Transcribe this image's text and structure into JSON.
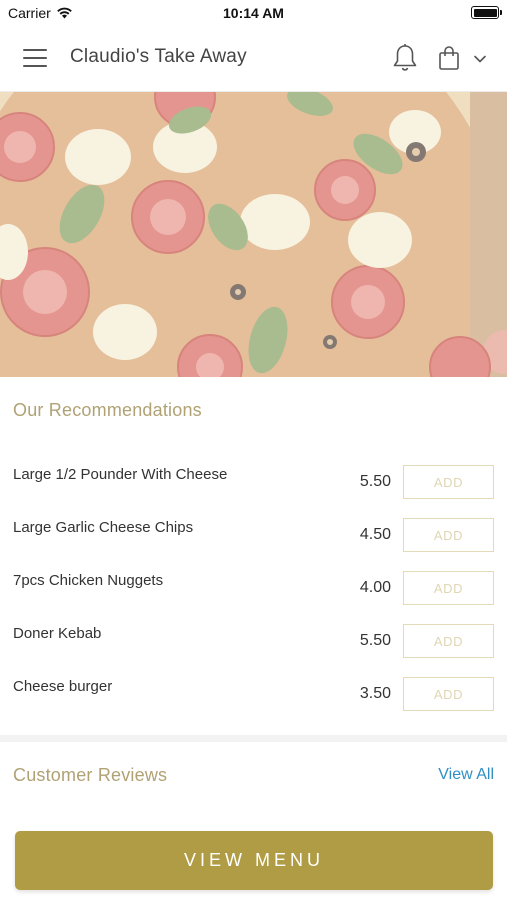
{
  "status_bar": {
    "carrier": "Carrier",
    "time": "10:14 AM"
  },
  "header": {
    "title": "Claudio's Take Away",
    "icons": [
      "menu-icon",
      "bell-icon",
      "shopping-bag-icon",
      "chevron-down-icon"
    ]
  },
  "hero": {
    "image": "pizza-photo"
  },
  "recommendations": {
    "heading": "Our Recommendations",
    "add_label": "ADD",
    "items": [
      {
        "name": "Large 1/2  Pounder With Cheese",
        "price": "5.50"
      },
      {
        "name": "Large Garlic Cheese Chips",
        "price": "4.50"
      },
      {
        "name": "7pcs Chicken Nuggets",
        "price": "4.00"
      },
      {
        "name": "Doner Kebab",
        "price": "5.50"
      },
      {
        "name": "Cheese burger",
        "price": "3.50"
      }
    ]
  },
  "reviews": {
    "heading": "Customer Reviews",
    "view_all": "View All"
  },
  "footer": {
    "view_menu": "VIEW MENU"
  },
  "colors": {
    "accent_gold": "#b19c46",
    "heading_gold": "#b0a274",
    "link_blue": "#2f8fc4",
    "add_border": "#e3dab9"
  }
}
